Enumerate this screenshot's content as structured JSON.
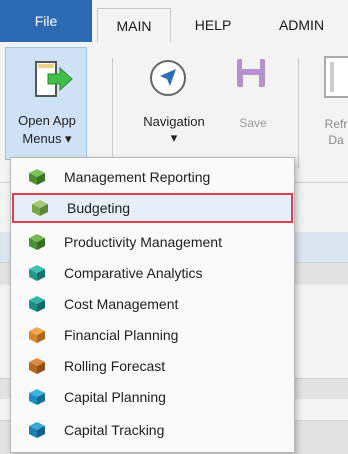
{
  "tabs": {
    "file": "File",
    "main": "MAIN",
    "help": "HELP",
    "admin": "ADMIN"
  },
  "ribbon": {
    "open_app_label_1": "Open App",
    "open_app_label_2": "Menus ▾",
    "navigation_label_1": "Navigation",
    "navigation_label_2": "▾",
    "save_label": "Save",
    "refresh_label_1": "Refr",
    "refresh_label_2": "Da"
  },
  "menu": {
    "items": [
      {
        "label": "Management Reporting",
        "color": "#5f9f3a",
        "icon": "cube-icon"
      },
      {
        "label": "Budgeting",
        "color": "#7aa44a",
        "icon": "cube-icon"
      },
      {
        "label": "Productivity Management",
        "color": "#4b8f34",
        "icon": "cube-icon"
      },
      {
        "label": "Comparative Analytics",
        "color": "#1f9a8c",
        "icon": "cube-icon"
      },
      {
        "label": "Cost Management",
        "color": "#1d8f86",
        "icon": "cube-icon"
      },
      {
        "label": "Financial Planning",
        "color": "#d48a2a",
        "icon": "cube-icon"
      },
      {
        "label": "Rolling Forecast",
        "color": "#b86a22",
        "icon": "cube-icon"
      },
      {
        "label": "Capital Planning",
        "color": "#1b8fbd",
        "icon": "cube-icon"
      },
      {
        "label": "Capital Tracking",
        "color": "#1a7fb0",
        "icon": "cube-icon"
      }
    ],
    "selected_index": 1
  },
  "colors": {
    "file_tab_bg": "#2c6ab4",
    "selection_outline": "#e0414c",
    "open_app_bg": "#cfe2f5"
  }
}
